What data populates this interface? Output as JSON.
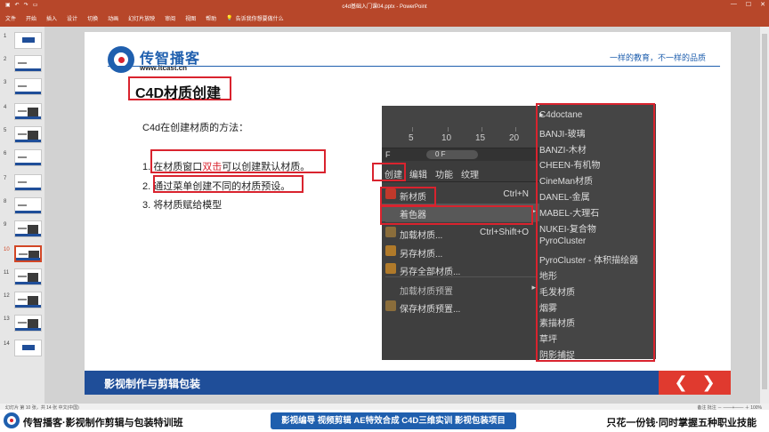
{
  "window": {
    "title": "c4d基础入门课04.pptx  -  PowerPoint",
    "controls": [
      "—",
      "☐",
      "✕"
    ]
  },
  "ribbon": {
    "tabs": [
      "文件",
      "开始",
      "插入",
      "设计",
      "切换",
      "动画",
      "幻灯片放映",
      "审阅",
      "视图",
      "帮助"
    ],
    "tell_me": "告诉我你想要做什么"
  },
  "thumbnails": [
    {
      "num": "1",
      "style": "title"
    },
    {
      "num": "2",
      "style": "text"
    },
    {
      "num": "3",
      "style": "text"
    },
    {
      "num": "4",
      "style": "dark"
    },
    {
      "num": "5",
      "style": "dark"
    },
    {
      "num": "6",
      "style": "text"
    },
    {
      "num": "7",
      "style": "text"
    },
    {
      "num": "8",
      "style": "text"
    },
    {
      "num": "9",
      "style": "dark"
    },
    {
      "num": "10",
      "style": "dark",
      "active": true
    },
    {
      "num": "11",
      "style": "dark"
    },
    {
      "num": "12",
      "style": "dark"
    },
    {
      "num": "13",
      "style": "dark"
    },
    {
      "num": "14",
      "style": "title"
    }
  ],
  "slide": {
    "logo_text": "传智播客",
    "logo_url": "www.itcast.cn",
    "slogan": "一样的教育，不一样的品质",
    "title": "C4D材质创建",
    "intro": "C4d在创建材质的方法：",
    "steps": [
      {
        "num": "1.",
        "before": "在材质窗口",
        "highlight": "双击",
        "after": "可以创建默认材质。"
      },
      {
        "num": "2.",
        "text": "通过菜单创建不同的材质预设。"
      },
      {
        "num": "3.",
        "text": "将材质赋给模型"
      }
    ],
    "footer": "影视制作与剪辑包装",
    "nav": {
      "prev": "❮",
      "next": "❯"
    }
  },
  "c4d": {
    "ruler": [
      "5",
      "10",
      "15",
      "20"
    ],
    "frame_label": "F",
    "frame_value": "0 F",
    "menu": [
      "创建",
      "编辑",
      "功能",
      "纹理"
    ],
    "dropdown": [
      {
        "label": "新材质",
        "shortcut": "Ctrl+N",
        "icon": "new-material-icon",
        "color": "#c0392b"
      },
      {
        "label": "着色器",
        "submenu": true,
        "highlighted": true
      },
      {
        "label": "加载材质...",
        "shortcut": "Ctrl+Shift+O",
        "icon": "load-material-icon",
        "color": "#8a6d3b"
      },
      {
        "label": "另存材质...",
        "icon": "save-material-icon",
        "color": "#b07a2a"
      },
      {
        "label": "另存全部材质...",
        "icon": "save-all-icon",
        "color": "#b07a2a"
      },
      {
        "label": "加载材质预置",
        "submenu": true,
        "dim": true
      },
      {
        "label": "保存材质预置...",
        "icon": "save-preset-icon",
        "color": "#8a6d3b"
      }
    ],
    "submenu": [
      {
        "label": "C4doctane",
        "arrow": true
      },
      {
        "label": "BANJI-玻璃"
      },
      {
        "label": "BANZI-木材"
      },
      {
        "label": "CHEEN-有机物"
      },
      {
        "label": "CineMan材质"
      },
      {
        "label": "DANEL-金属"
      },
      {
        "label": "MABEL-大理石"
      },
      {
        "label": "NUKEI-复合物"
      },
      {
        "label": "PyroCluster"
      },
      {
        "label": "PyroCluster - 体积描绘器"
      },
      {
        "label": "地形"
      },
      {
        "label": "毛发材质"
      },
      {
        "label": "烟雾"
      },
      {
        "label": "素描材质"
      },
      {
        "label": "草坪"
      },
      {
        "label": "阴影捕捉"
      }
    ]
  },
  "statusbar": {
    "left": "幻灯片 第 10 张，共 14 张    中文(中国)",
    "right": "备注   批注     －  ——+——  ＋  100%"
  },
  "banner": {
    "left": "传智播客·影视制作剪辑与包装特训班",
    "middle": "影视编导  视频剪辑  AE特效合成  C4D三维实训  影视包装项目",
    "right": "只花一份钱·同时掌握五种职业技能"
  }
}
